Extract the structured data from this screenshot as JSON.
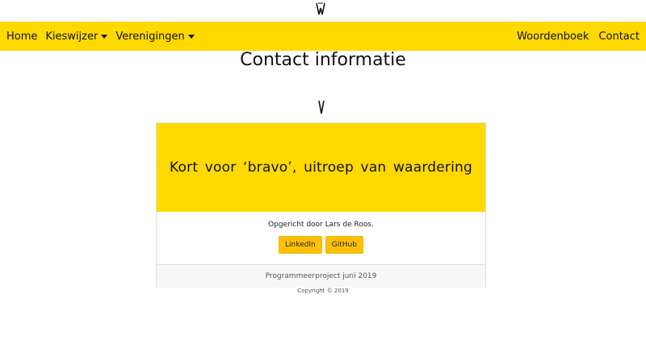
{
  "nav": {
    "left": [
      {
        "label": "Home",
        "dropdown": false
      },
      {
        "label": "Kieswijzer",
        "dropdown": true
      },
      {
        "label": "Verenigingen",
        "dropdown": true
      }
    ],
    "right": [
      {
        "label": "Woordenboek"
      },
      {
        "label": "Contact"
      }
    ]
  },
  "page": {
    "title": "Contact informatie"
  },
  "card": {
    "tagline": "Kort voor ‘bravo’, uitroep van waardering",
    "founded_text": "Opgericht door Lars de Roos.",
    "buttons": {
      "linkedin": "LinkedIn",
      "github": "GitHub"
    },
    "footer": "Programmeerproject juni 2019"
  },
  "copyright": "Copyright © 2019",
  "colors": {
    "accent": "#ffd900",
    "button": "#ffc107"
  }
}
